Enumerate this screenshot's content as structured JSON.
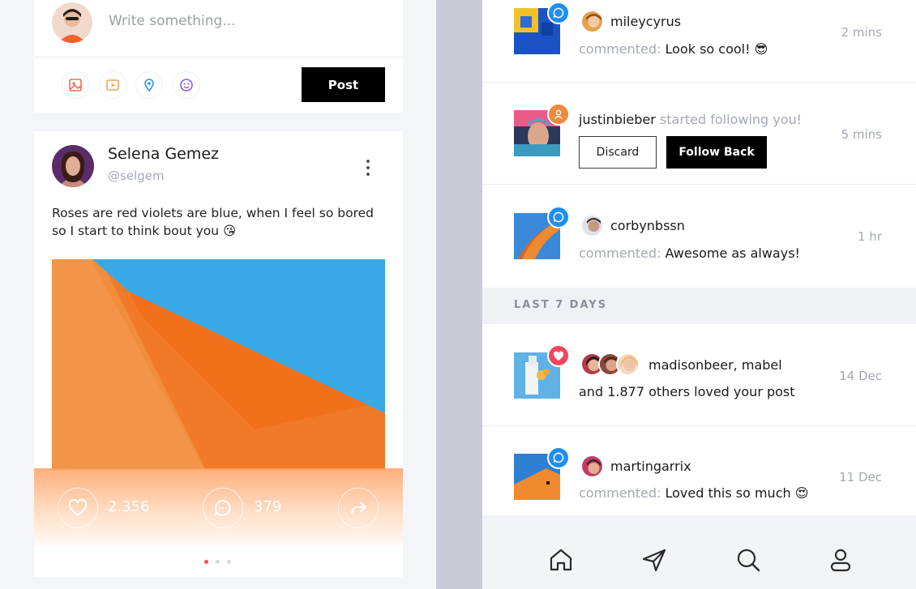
{
  "composer": {
    "placeholder": "Write something...",
    "post_label": "Post",
    "tools": [
      "image-icon",
      "video-icon",
      "location-icon",
      "emoji-icon"
    ]
  },
  "post": {
    "name": "Selena Gemez",
    "handle": "@selgem",
    "text": "Roses are red violets are blue, when I feel so bored so I start to think bout you 😘",
    "likes": "2.356",
    "comments": "379",
    "page_dots": 3,
    "active_dot": 0
  },
  "notifications": [
    {
      "user": "mileycyrus",
      "action_prefix": "commented:",
      "action_text": "Look so cool! 😎",
      "time": "2 mins",
      "badge": "comment-badge-icon"
    },
    {
      "user": "justinbieber",
      "action_suffix": "started following you!",
      "time": "5 mins",
      "badge": "follow-badge-icon",
      "discard_label": "Discard",
      "follow_label": "Follow Back"
    },
    {
      "user": "corbynbssn",
      "action_prefix": "commented:",
      "action_text": "Awesome as always!",
      "time": "1 hr",
      "badge": "comment-badge-icon"
    }
  ],
  "section_label": "LAST 7 DAYS",
  "older_notifications": [
    {
      "user": "madisonbeer, mabel",
      "action_text": "and 1.877 others loved your post",
      "time": "14 Dec",
      "badge": "heart-badge-icon"
    },
    {
      "user": "martingarrix",
      "action_prefix": "commented:",
      "action_text": "Loved this so much 😍",
      "time": "11 Dec",
      "badge": "comment-badge-icon"
    }
  ],
  "nav": [
    "home-icon",
    "send-icon",
    "search-icon",
    "profile-icon"
  ],
  "colors": {
    "accent_blue": "#1f8ef1",
    "accent_orange": "#f08a3c",
    "heart_red": "#ef4560",
    "dot_active": "#ff4d4d"
  }
}
